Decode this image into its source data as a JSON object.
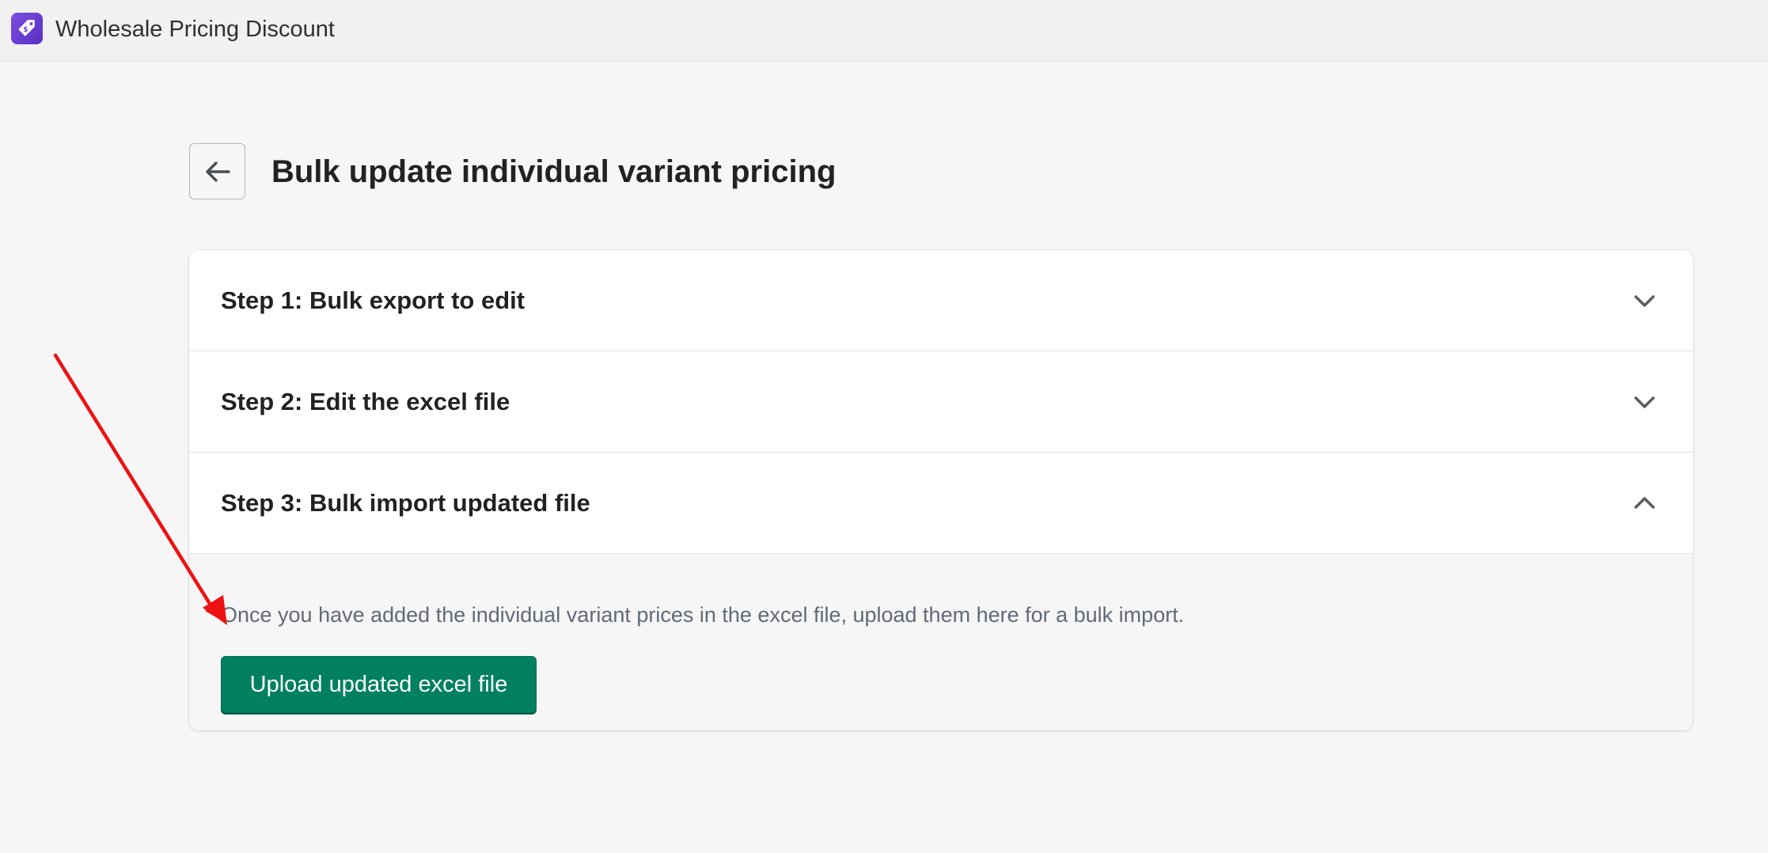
{
  "header": {
    "app_title": "Wholesale Pricing Discount",
    "app_icon": "price-tag-icon"
  },
  "page": {
    "back_icon": "arrow-left-icon",
    "title": "Bulk update individual variant pricing"
  },
  "steps": [
    {
      "label": "Step 1: Bulk export to edit",
      "expanded": false,
      "icon": "chevron-down-icon"
    },
    {
      "label": "Step 2: Edit the excel file",
      "expanded": false,
      "icon": "chevron-down-icon"
    },
    {
      "label": "Step 3: Bulk import updated file",
      "expanded": true,
      "icon": "chevron-up-icon"
    }
  ],
  "step3": {
    "description": "Once you have added the individual variant prices in the excel file, upload them here for a bulk import.",
    "upload_button_label": "Upload updated excel file"
  },
  "colors": {
    "primary_button": "#008060",
    "app_icon": "#6b3fd6",
    "annotation_arrow": "#ee1111"
  }
}
